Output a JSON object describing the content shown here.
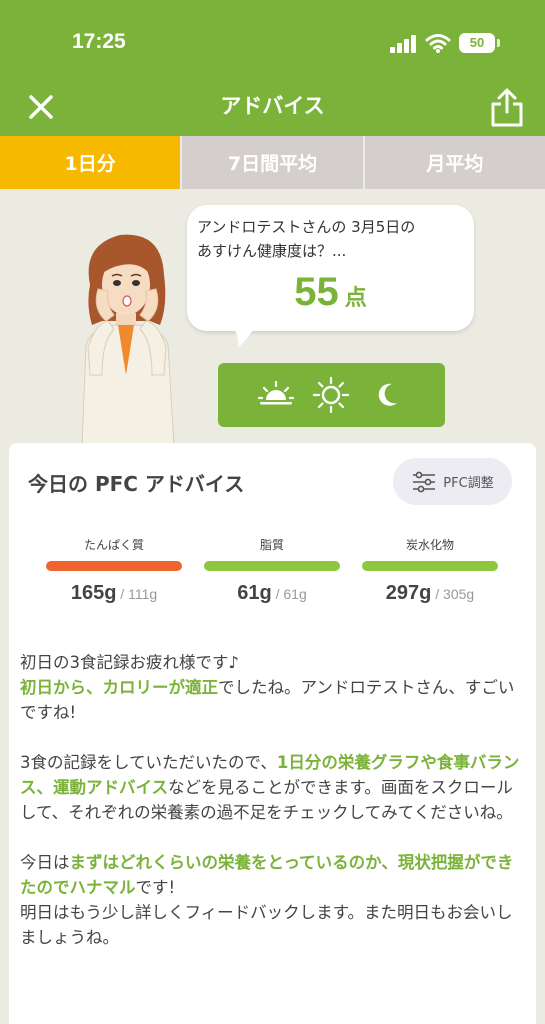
{
  "status_bar": {
    "time": "17:25",
    "battery": "50"
  },
  "nav": {
    "title": "アドバイス"
  },
  "tabs": [
    {
      "label": "1日分",
      "active": true
    },
    {
      "label": "7日間平均",
      "active": false
    },
    {
      "label": "月平均",
      "active": false
    }
  ],
  "bubble": {
    "line1": "アンドロテストさんの 3月5日の",
    "line2": "あすけん健康度は？...",
    "score": "55",
    "unit": "点"
  },
  "meal_icons": [
    "sunrise-icon",
    "sun-icon",
    "moon-icon"
  ],
  "card": {
    "title": "今日の PFC アドバイス",
    "pfc_button": "PFC調整"
  },
  "nutrients": [
    {
      "label": "たんぱく質",
      "value": "165g",
      "target": " / 111g",
      "color": "#f0652f"
    },
    {
      "label": "脂質",
      "value": "61g",
      "target": " / 61g",
      "color": "#8dc63f"
    },
    {
      "label": "炭水化物",
      "value": "297g",
      "target": " / 305g",
      "color": "#8dc63f"
    }
  ],
  "advice": {
    "p1_a": "初日の3食記録お疲れ様です♪",
    "p1_hl": "初日から、カロリーが適正",
    "p1_b": "でしたね。アンドロテストさん、すごいですね!",
    "p2_a": "3食の記録をしていただいたので、",
    "p2_hl": "1日分の栄養グラフや食事バランス、運動アドバイス",
    "p2_b": "などを見ることができます。画面をスクロールして、それぞれの栄養素の過不足をチェックしてみてくださいね。",
    "p3_a": "今日は",
    "p3_hl": "まずはどれくらいの栄養をとっているのか、現状把握ができたのでハナマル",
    "p3_b": "です!",
    "p3_c": "明日はもう少し詳しくフィードバックします。また明日もお会いしましょうね。"
  },
  "colors": {
    "brand_green": "#7bb33a",
    "tab_active": "#f7b900",
    "tab_inactive": "#d4cfcc",
    "protein": "#f0652f"
  }
}
